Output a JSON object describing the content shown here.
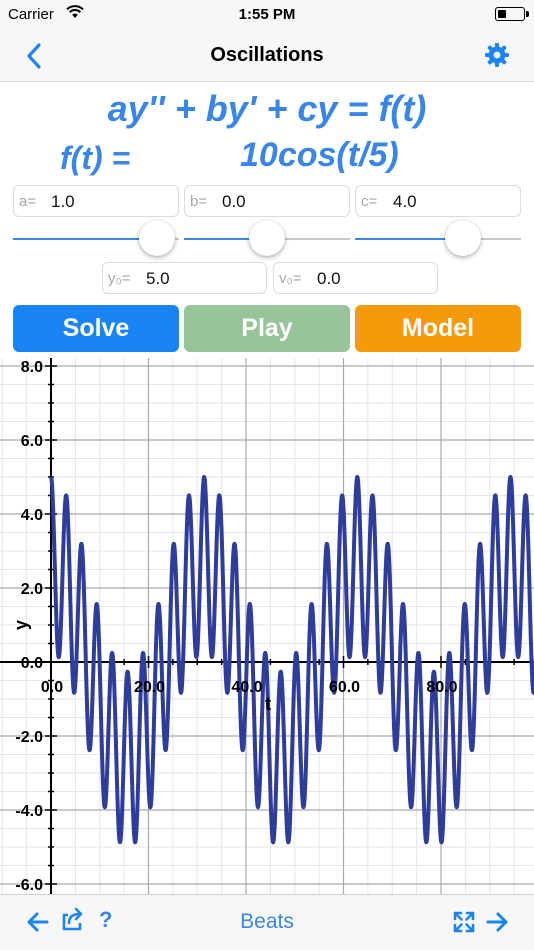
{
  "status": {
    "carrier": "Carrier",
    "time": "1:55 PM",
    "battery_level": 0.35
  },
  "nav": {
    "title": "Oscillations"
  },
  "equation": {
    "text": "ay'' + by' + cy = f(t)",
    "forcing_label": "f(t) =",
    "forcing_value": "10cos(t/5)"
  },
  "params": {
    "a": {
      "label": "a=",
      "value": "1.0",
      "slider_fraction": 0.87
    },
    "b": {
      "label": "b=",
      "value": "0.0",
      "slider_fraction": 0.5
    },
    "c": {
      "label": "c=",
      "value": "4.0",
      "slider_fraction": 0.65
    }
  },
  "initial": {
    "y0": {
      "label": "y₀=",
      "value": "5.0"
    },
    "v0": {
      "label": "v₀=",
      "value": "0.0"
    }
  },
  "buttons": {
    "solve": {
      "label": "Solve",
      "color": "#1a84f5"
    },
    "play": {
      "label": "Play",
      "color": "#98c49a"
    },
    "model": {
      "label": "Model",
      "color": "#f69a0c"
    }
  },
  "chart_data": {
    "type": "line",
    "title": "",
    "xlabel": "t",
    "ylabel": "y",
    "xlim": [
      0,
      98
    ],
    "ylim": [
      -6.1,
      8.1
    ],
    "x_ticks": [
      "0.0",
      "20.0",
      "40.0",
      "60.0",
      "80.0"
    ],
    "y_ticks": [
      "-6.0",
      "-4.0",
      "-2.0",
      "0.0",
      "2.0",
      "4.0",
      "6.0",
      "8.0"
    ],
    "grid": true,
    "line_color": "#2e3d9b",
    "series": [
      {
        "expression": "y(t) = (5 - 50/19)cos(2t) + (50/19)cos(t/5)",
        "amplitude_max": 5.0,
        "amplitude_min": -4.9
      }
    ]
  },
  "toolbar": {
    "title": "Beats",
    "help": "?"
  },
  "icons": {
    "back": "chevron-left-icon",
    "settings": "gear-icon",
    "prev": "arrow-left-icon",
    "share": "share-icon",
    "expand": "expand-icon",
    "next": "arrow-right-icon"
  },
  "accent_color": "#3a86e8"
}
